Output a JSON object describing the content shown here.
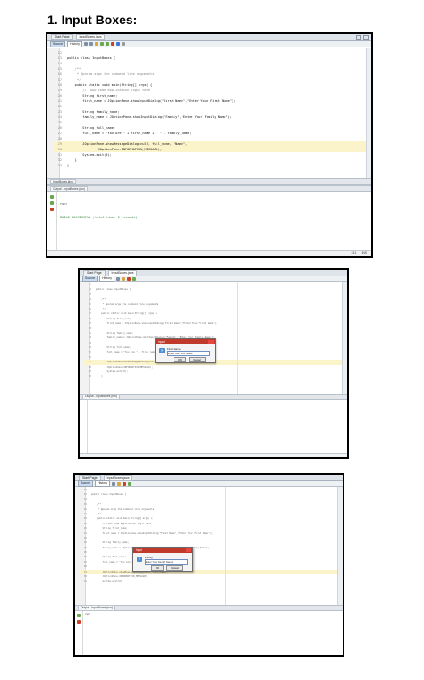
{
  "heading": "1. Input Boxes:",
  "shot1": {
    "tabs": [
      "Start Page",
      "InputBoxes.java"
    ],
    "toolbar": {
      "source": "Source",
      "history": "History"
    },
    "code": [
      {
        "n": "12",
        "t": ""
      },
      {
        "n": "13",
        "t": "public class InputBoxes {",
        "kind": "code"
      },
      {
        "n": "14",
        "t": ""
      },
      {
        "n": "15",
        "t": "    /**",
        "kind": "cm"
      },
      {
        "n": "16",
        "t": "     * @param args the command line arguments",
        "kind": "cm"
      },
      {
        "n": "17",
        "t": "     */",
        "kind": "cm"
      },
      {
        "n": "18",
        "t": "    public static void main(String[] args) {",
        "kind": "code"
      },
      {
        "n": "19",
        "t": "        // TODO code application logic here",
        "kind": "cm"
      },
      {
        "n": "20",
        "t": "        String first_name;",
        "kind": "code"
      },
      {
        "n": "21",
        "t": "        first_name = JOptionPane.showInputDialog(\"First Name\",\"Enter Your First Name\");",
        "kind": "code"
      },
      {
        "n": "22",
        "t": ""
      },
      {
        "n": "23",
        "t": "        String family_name;",
        "kind": "code"
      },
      {
        "n": "24",
        "t": "        family_name = JOptionPane.showInputDialog(\"Family\",\"Enter Your Family Name\");",
        "kind": "code"
      },
      {
        "n": "25",
        "t": ""
      },
      {
        "n": "26",
        "t": "        String full_name;",
        "kind": "code"
      },
      {
        "n": "27",
        "t": "        full_name = \"You Are \" + first_name + \" \" + family_name;",
        "kind": "code"
      },
      {
        "n": "28",
        "t": ""
      },
      {
        "n": "29",
        "t": "        JOptionPane.showMessageDialog(null, full_name, \"Name\",",
        "kind": "hl"
      },
      {
        "n": "30",
        "t": "                JOptionPane.INFORMATION_MESSAGE);",
        "kind": "hl"
      },
      {
        "n": "31",
        "t": "        System.exit(0);",
        "kind": "code"
      },
      {
        "n": "32",
        "t": "    }",
        "kind": "code"
      },
      {
        "n": "33",
        "t": "}",
        "kind": "code"
      }
    ],
    "output_title": "Output - InputBoxes (run)",
    "output_lines": [
      "run:",
      "BUILD SUCCESSFUL (total time: 2 seconds)"
    ],
    "status": {
      "position": "33:1",
      "mode": "INS"
    }
  },
  "shot2": {
    "tabs": [
      "Start Page",
      "InputBoxes.java"
    ],
    "toolbar": {
      "source": "Source",
      "history": "History"
    },
    "code": [
      {
        "n": "11",
        "t": ""
      },
      {
        "n": "12",
        "t": "public class InputBoxes {"
      },
      {
        "n": "13",
        "t": ""
      },
      {
        "n": "14",
        "t": "    /**"
      },
      {
        "n": "15",
        "t": "     * @param args the command line arguments"
      },
      {
        "n": "16",
        "t": "     */"
      },
      {
        "n": "17",
        "t": "    public static void main(String[] args) {"
      },
      {
        "n": "18",
        "t": "        String first_name;"
      },
      {
        "n": "19",
        "t": "        first_name = JOptionPane.showInputDialog(\"First Name\",\"Enter Your First Name\");"
      },
      {
        "n": "20",
        "t": ""
      },
      {
        "n": "21",
        "t": "        String family_name;"
      },
      {
        "n": "22",
        "t": "        family_name = JOptionPane.showInputDialog(\"Family\",\"Enter Your Family Name\");"
      },
      {
        "n": "23",
        "t": ""
      },
      {
        "n": "24",
        "t": "        String full_name;"
      },
      {
        "n": "25",
        "t": "        full_name = \"You Are \" + first_name + \" \" + family_name;"
      },
      {
        "n": "26",
        "t": ""
      },
      {
        "n": "27",
        "t": "        JOptionPane.showMessageDialog(null, full_name);",
        "kind": "hl"
      },
      {
        "n": "28",
        "t": "        JOptionPane.INFORMATION_MESSAGE);"
      },
      {
        "n": "29",
        "t": "        System.exit(0);"
      },
      {
        "n": "30",
        "t": "    }"
      }
    ],
    "dialog": {
      "title": "Input",
      "label": "First Name",
      "value": "Enter Your First Name",
      "ok": "OK",
      "cancel": "Cancel"
    },
    "output_title": "Output - InputBoxes (run)"
  },
  "shot3": {
    "tabs": [
      "Start Page",
      "InputBoxes.java"
    ],
    "toolbar": {
      "source": "Source",
      "history": "History"
    },
    "code": [
      {
        "n": "12",
        "t": ""
      },
      {
        "n": "13",
        "t": "public class InputBoxes {"
      },
      {
        "n": "14",
        "t": ""
      },
      {
        "n": "15",
        "t": "    /**"
      },
      {
        "n": "16",
        "t": "     * @param args the command line arguments"
      },
      {
        "n": "17",
        "t": "     */"
      },
      {
        "n": "18",
        "t": "    public static void main(String[] args) {"
      },
      {
        "n": "19",
        "t": "        // TODO code application logic here"
      },
      {
        "n": "20",
        "t": "        String first_name;"
      },
      {
        "n": "21",
        "t": "        first_name = JOptionPane.showInputDialog(\"First Name\",\"Enter Your First Name\");"
      },
      {
        "n": "22",
        "t": ""
      },
      {
        "n": "23",
        "t": "        String family_name;"
      },
      {
        "n": "24",
        "t": "        family_name = JOptionPane.showInputDialog(\"Family\",\"Enter Your Family Name\");"
      },
      {
        "n": "25",
        "t": ""
      },
      {
        "n": "26",
        "t": "        String full_name;"
      },
      {
        "n": "27",
        "t": "        full_name = \"You Are \" + first_name + \" \" + family_name;"
      },
      {
        "n": "28",
        "t": ""
      },
      {
        "n": "29",
        "t": "        JOptionPane.showMessageDialog(null, full_name);",
        "kind": "hl"
      },
      {
        "n": "30",
        "t": "        JOptionPane.INFORMATION_MESSAGE);"
      },
      {
        "n": "31",
        "t": "        System.exit(0);"
      }
    ],
    "dialog": {
      "title": "Input",
      "label": "Family",
      "value": "Enter Your Family Name",
      "ok": "OK",
      "cancel": "Cancel"
    },
    "output_title": "Output - InputBoxes (run)",
    "output_lines": [
      "run:"
    ]
  }
}
